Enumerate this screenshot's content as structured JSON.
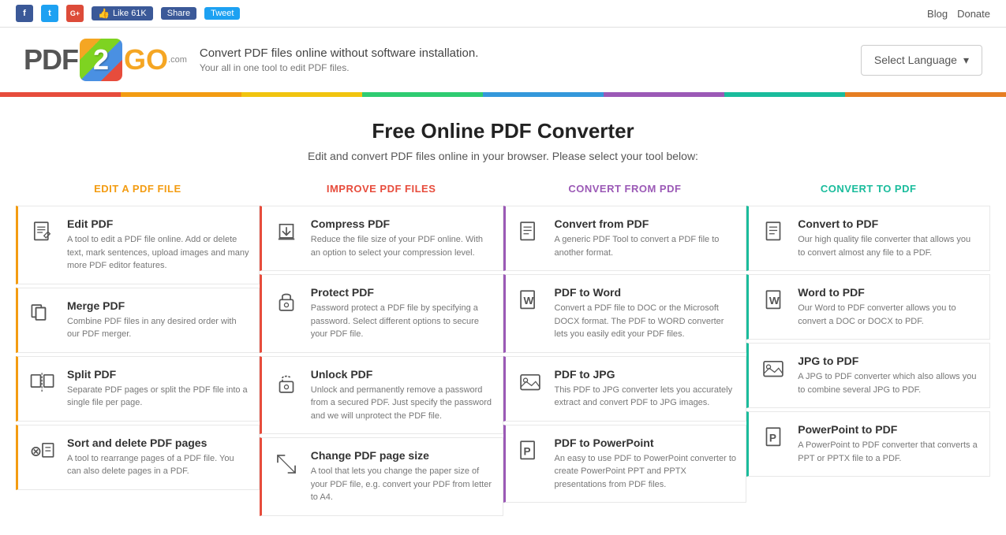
{
  "topbar": {
    "blog_label": "Blog",
    "donate_label": "Donate",
    "social": {
      "facebook_label": "f",
      "twitter_label": "t",
      "google_label": "G+",
      "like_label": "Like 61K",
      "share_label": "Share",
      "tweet_label": "Tweet"
    }
  },
  "header": {
    "logo_pdf": "PDF",
    "logo_2": "2",
    "logo_go": "GO",
    "logo_dot": ".com",
    "tagline": "Convert PDF files online without software installation.",
    "tagline_sub": "Your all in one tool to edit PDF files.",
    "lang_button": "Select Language"
  },
  "hero": {
    "title": "Free Online PDF Converter",
    "subtitle": "Edit and convert PDF files online in your browser. Please select your tool below:"
  },
  "columns": [
    {
      "id": "edit",
      "header": "Edit a PDF File",
      "color_class": "col-edit",
      "tools": [
        {
          "title": "Edit PDF",
          "desc": "A tool to edit a PDF file online. Add or delete text, mark sentences, upload images and many more PDF editor features."
        },
        {
          "title": "Merge PDF",
          "desc": "Combine PDF files in any desired order with our PDF merger."
        },
        {
          "title": "Split PDF",
          "desc": "Separate PDF pages or split the PDF file into a single file per page."
        },
        {
          "title": "Sort and delete PDF pages",
          "desc": "A tool to rearrange pages of a PDF file. You can also delete pages in a PDF."
        }
      ]
    },
    {
      "id": "improve",
      "header": "Improve PDF Files",
      "color_class": "col-improve",
      "tools": [
        {
          "title": "Compress PDF",
          "desc": "Reduce the file size of your PDF online. With an option to select your compression level."
        },
        {
          "title": "Protect PDF",
          "desc": "Password protect a PDF file by specifying a password. Select different options to secure your PDF file."
        },
        {
          "title": "Unlock PDF",
          "desc": "Unlock and permanently remove a password from a secured PDF. Just specify the password and we will unprotect the PDF file."
        },
        {
          "title": "Change PDF page size",
          "desc": "A tool that lets you change the paper size of your PDF file, e.g. convert your PDF from letter to A4."
        }
      ]
    },
    {
      "id": "from",
      "header": "Convert From PDF",
      "color_class": "col-from",
      "tools": [
        {
          "title": "Convert from PDF",
          "desc": "A generic PDF Tool to convert a PDF file to another format."
        },
        {
          "title": "PDF to Word",
          "desc": "Convert a PDF file to DOC or the Microsoft DOCX format. The PDF to WORD converter lets you easily edit your PDF files."
        },
        {
          "title": "PDF to JPG",
          "desc": "This PDF to JPG converter lets you accurately extract and convert PDF to JPG images."
        },
        {
          "title": "PDF to PowerPoint",
          "desc": "An easy to use PDF to PowerPoint converter to create PowerPoint PPT and PPTX presentations from PDF files."
        }
      ]
    },
    {
      "id": "to",
      "header": "Convert to PDF",
      "color_class": "col-to",
      "tools": [
        {
          "title": "Convert to PDF",
          "desc": "Our high quality file converter that allows you to convert almost any file to a PDF."
        },
        {
          "title": "Word to PDF",
          "desc": "Our Word to PDF converter allows you to convert a DOC or DOCX to PDF."
        },
        {
          "title": "JPG to PDF",
          "desc": "A JPG to PDF converter which also allows you to combine several JPG to PDF."
        },
        {
          "title": "PowerPoint to PDF",
          "desc": "A PowerPoint to PDF converter that converts a PPT or PPTX file to a PDF."
        }
      ]
    }
  ]
}
